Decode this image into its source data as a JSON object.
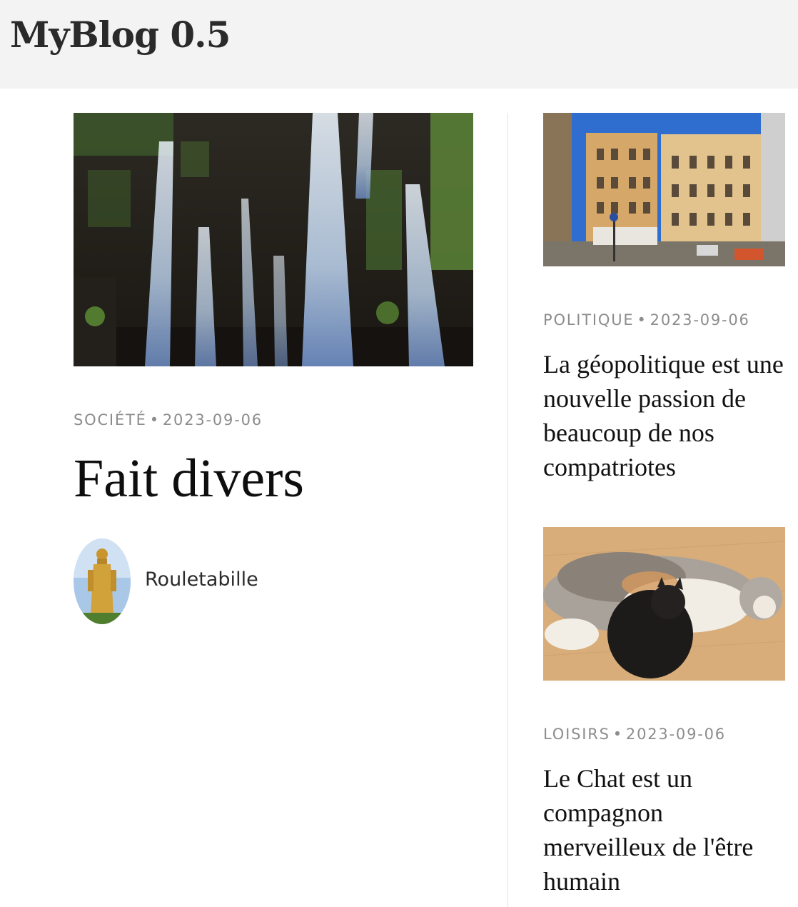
{
  "site": {
    "title": "MyBlog 0.5"
  },
  "featured": {
    "category": "SOCIÉTÉ",
    "separator": "•",
    "date": "2023-09-06",
    "title": "Fait divers",
    "image_alt": "waterfall",
    "author": {
      "name": "Rouletabille",
      "avatar_alt": "golden buddha statue"
    }
  },
  "side_articles": [
    {
      "category": "POLITIQUE",
      "separator": "•",
      "date": "2023-09-06",
      "title": "La géopolitique est une nouvelle passion de beaucoup de nos compatriotes",
      "image_alt": "city street with buildings"
    },
    {
      "category": "LOISIRS",
      "separator": "•",
      "date": "2023-09-06",
      "title": "Le Chat est un compagnon merveilleux de l'être humain",
      "image_alt": "cats on wooden floor"
    }
  ],
  "colors": {
    "header_bg": "#f3f3f3",
    "meta_text": "#8c8c8c",
    "divider": "#e4e4e4"
  }
}
